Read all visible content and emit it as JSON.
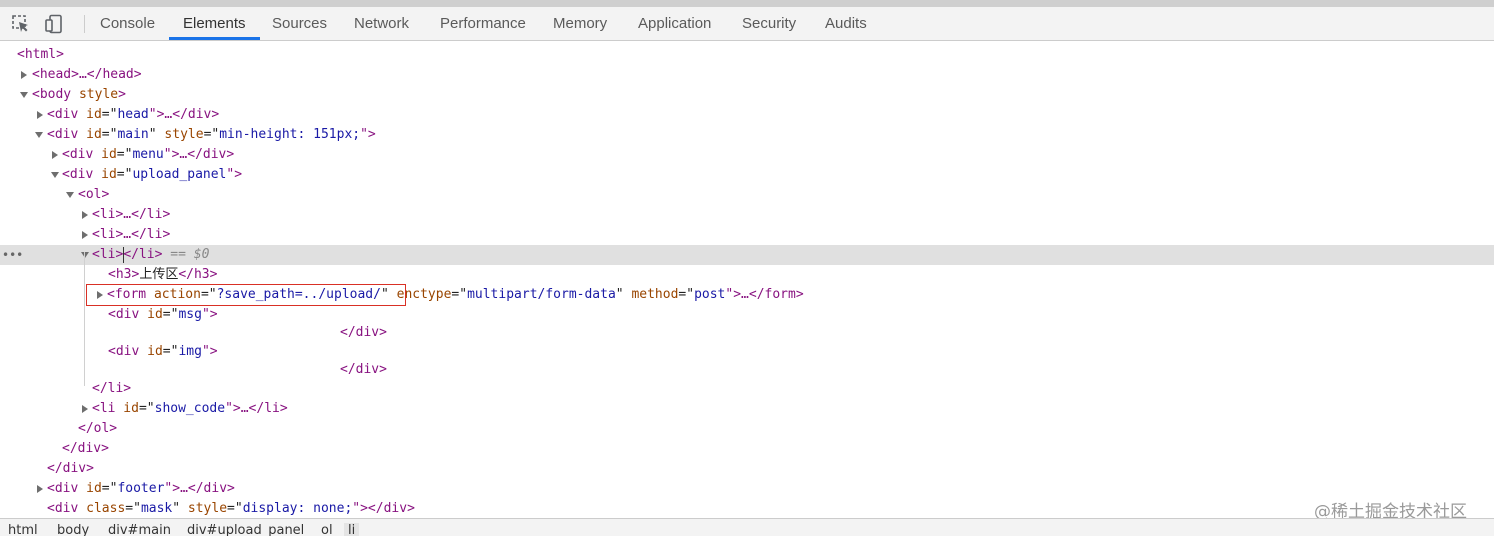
{
  "toolbar": {
    "icons": [
      "inspect-element-icon",
      "device-toolbar-icon"
    ],
    "tabs": [
      {
        "label": "Console"
      },
      {
        "label": "Elements"
      },
      {
        "label": "Sources"
      },
      {
        "label": "Network"
      },
      {
        "label": "Performance"
      },
      {
        "label": "Memory"
      },
      {
        "label": "Application"
      },
      {
        "label": "Security"
      },
      {
        "label": "Audits"
      }
    ],
    "active_tab": "Elements",
    "accent_color": "#1a73e8"
  },
  "tree": {
    "ellipsis": "…",
    "selected_marker": "== $0",
    "gutter_dots": "•••",
    "lines": {
      "html_open": "<html>",
      "head": "<head>…</head>",
      "body_tag": "<body",
      "body_attr": " style",
      "body_close": ">",
      "div_open": "<div",
      "id_attr": " id",
      "class_attr": " class",
      "style_attr": " style",
      "eq_q": "=\"",
      "q_close": "\">",
      "q_space": "\"",
      "head_id": "head",
      "collapsed_div_end": "…</div>",
      "main_id": "main",
      "main_style": "min-height: 151px;",
      "menu_id": "menu",
      "upload_panel_id": "upload_panel",
      "ol_open": "<ol>",
      "li_collapsed": "<li>…</li>",
      "li_open": "<li>",
      "li_close_inline": "</li>",
      "h3_open": "<h3>",
      "h3_text": "上传区",
      "h3_close": "</h3>",
      "form_open": "<form",
      "action_attr": " action",
      "form_action": "?save_path=../upload/",
      "enctype_attr": " enctype",
      "form_enctype": "multipart/form-data",
      "method_attr": " method",
      "form_method": "post",
      "form_end": "\">…</form>",
      "msg_id": "msg",
      "img_id": "img",
      "div_close": "</div>",
      "li_close": "</li>",
      "li_show_code_open": "<li",
      "show_code_id": "show_code",
      "li_collapsed_end": "…</li>",
      "ol_close": "</ol>",
      "footer_id": "footer",
      "mask_class": "mask",
      "mask_style": "display: none;",
      "mask_end": "\"></div>"
    }
  },
  "breadcrumb": {
    "items": [
      "html",
      "body",
      "div#main",
      "div#upload_panel",
      "ol",
      "li"
    ],
    "active": "li"
  },
  "watermark": "@稀土掘金技术社区",
  "colors": {
    "tag": "#881280",
    "attr_name": "#994500",
    "attr_value": "#1a1aa6",
    "selection_bg": "#e0e0e0",
    "highlight_border": "#d93025"
  }
}
